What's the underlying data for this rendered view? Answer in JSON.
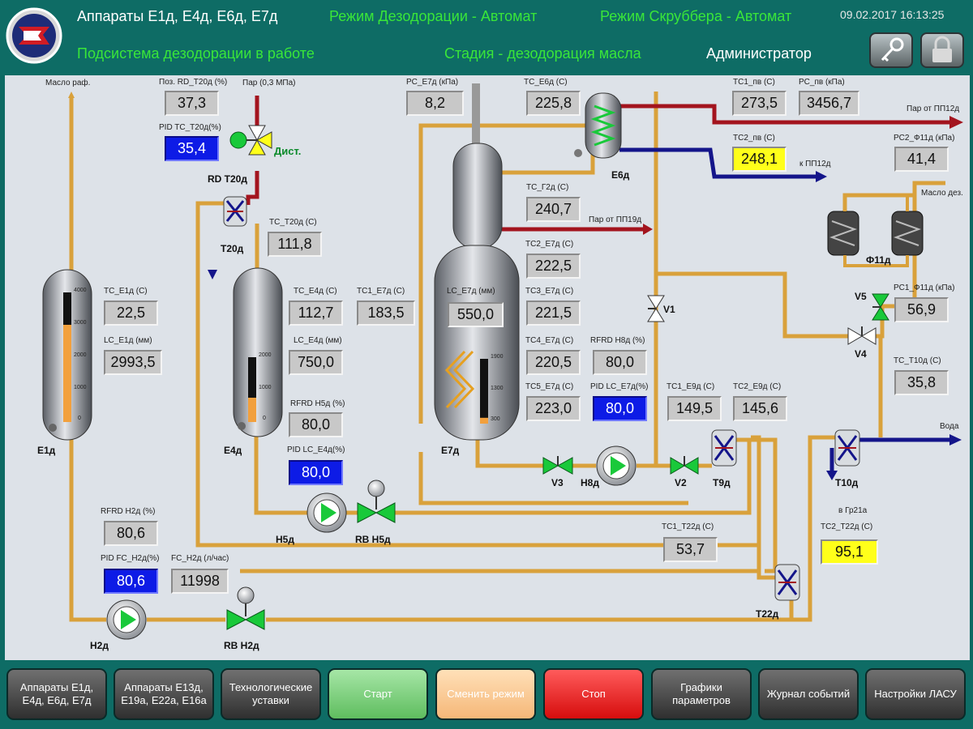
{
  "header": {
    "title": "Аппараты Е1д, Е4д, Е6д, Е7д",
    "subsystem": "Подсистема дезодорации в работе",
    "mode_deodor": "Режим Дезодорации - Автомат",
    "mode_scrubber": "Режим Скруббера - Автомат",
    "stage": "Стадия -  дезодорация масла",
    "user": "Администратор",
    "datetime": "09.02.2017 16:13:25"
  },
  "labels": {
    "maslo_raf": "Масло раф.",
    "poz_rd": "Поз. RD_T20д (%)",
    "par": "Пар (0,3 МПа)",
    "pid_tc_t20": "PID TC_T20д(%)",
    "dist": "Дист.",
    "rd_t20": "RD T20д",
    "t20": "T20д",
    "tc_t20": "TC_T20д (C)",
    "pc_e7": "PC_E7д (кПа)",
    "tc_e6": "TC_E6д (C)",
    "tc1_pv": "TC1_пв (C)",
    "pc_pv": "PC_пв (кПа)",
    "par_ot_pp12": "Пар от ПП12д",
    "tc2_pv": "TC2_пв (C)",
    "k_pp12": "к ПП12д",
    "pc2_f11": "PC2_Ф11д (кПа)",
    "e6": "Е6д",
    "maslo_dez": "Масло дез.",
    "tc_g2": "TC_Г2д (C)",
    "par_ot_pp19": "Пар от ПП19д",
    "f11": "Ф11д",
    "tc_e1": "TC_E1д (C)",
    "lc_e1": "LC_E1д (мм)",
    "tc_e4": "TC_E4д (C)",
    "tc1_e7": "TC1_E7д (C)",
    "lc_e7": "LC_E7д (мм)",
    "tc2_e7": "TC2_E7д (C)",
    "tc3_e7": "TC3_E7д (C)",
    "lc_e4": "LC_E4д (мм)",
    "tc4_e7": "TC4_E7д (C)",
    "rfrd_h8": "RFRD H8д (%)",
    "v1": "V1",
    "v5": "V5",
    "pc1_f11": "PC1_Ф11д (кПа)",
    "v4": "V4",
    "tc_t10": "TC_T10д (C)",
    "rfrd_h5": "RFRD H5д (%)",
    "tc5_e7": "TC5_E7д (C)",
    "pid_lc_e7": "PID LC_E7д(%)",
    "tc1_e9": "TC1_E9д (C)",
    "tc2_e9": "TC2_E9д (C)",
    "voda": "Вода",
    "e1": "Е1д",
    "e4": "Е4д",
    "e7": "Е7д",
    "pid_lc_e4": "PID LC_E4д(%)",
    "v3": "V3",
    "h8": "H8д",
    "v2": "V2",
    "t9": "T9д",
    "t10": "T10д",
    "h5": "H5д",
    "rb_h5": "RB H5д",
    "v_gr21": "в Гр21а",
    "tc2_t22": "TC2_T22д (C)",
    "rfrd_h2": "RFRD H2д (%)",
    "tc1_t22": "TC1_T22д (C)",
    "pid_fc_h2": "PID FC_H2д(%)",
    "fc_h2": "FC_H2д (л/час)",
    "t22": "T22д",
    "h2": "H2д",
    "rb_h2": "RB H2д"
  },
  "scales": {
    "e1": [
      "4000",
      "3000",
      "2000",
      "1000",
      "0"
    ],
    "e4": [
      "2000",
      "1000",
      "0"
    ],
    "e7": [
      "1900",
      "1300",
      "300"
    ]
  },
  "values": {
    "poz_rd": "37,3",
    "pid_tc_t20": "35,4",
    "tc_t20": "111,8",
    "pc_e7": "8,2",
    "tc_e6": "225,8",
    "tc1_pv": "273,5",
    "pc_pv": "3456,7",
    "tc2_pv": "248,1",
    "pc2_f11": "41,4",
    "tc_g2": "240,7",
    "tc2_e7": "222,5",
    "tc_e1": "22,5",
    "lc_e1": "2993,5",
    "tc_e4": "112,7",
    "tc1_e7": "183,5",
    "lc_e7": "550,0",
    "tc3_e7": "221,5",
    "pc1_f11": "56,9",
    "lc_e4": "750,0",
    "tc4_e7": "220,5",
    "rfrd_h8": "80,0",
    "tc_t10": "35,8",
    "rfrd_h5": "80,0",
    "tc5_e7": "223,0",
    "pid_lc_e7": "80,0",
    "tc1_e9": "149,5",
    "tc2_e9": "145,6",
    "pid_lc_e4": "80,0",
    "tc2_t22": "95,1",
    "rfrd_h2": "80,6",
    "tc1_t22": "53,7",
    "pid_fc_h2": "80,6",
    "fc_h2": "11998"
  },
  "levels": {
    "e1_fraction": 0.75,
    "e4_fraction": 0.375,
    "e7_fraction": 0.09
  },
  "footer": {
    "btn1": "Аппараты Е1д, Е4д, Е6д, Е7д",
    "btn2": "Аппараты Е13д, Е19а, Е22а, Е16а",
    "btn3": "Технологические уставки",
    "btn4": "Старт",
    "btn5": "Сменить режим",
    "btn6": "Стоп",
    "btn7": "Графики параметров",
    "btn8": "Журнал событий",
    "btn9": "Настройки ЛАСУ"
  },
  "colors": {
    "oil_pipe": "#d9a13b",
    "steam_pipe": "#a3141e",
    "water_pipe": "#14158a",
    "level_fill": "#f2a03d",
    "header_bg": "#0e6c65",
    "pid_blue": "#0d1be6",
    "alarm_yellow": "#ffff1a"
  },
  "icons": [
    "logo-icon",
    "key-icon",
    "lock-icon"
  ]
}
